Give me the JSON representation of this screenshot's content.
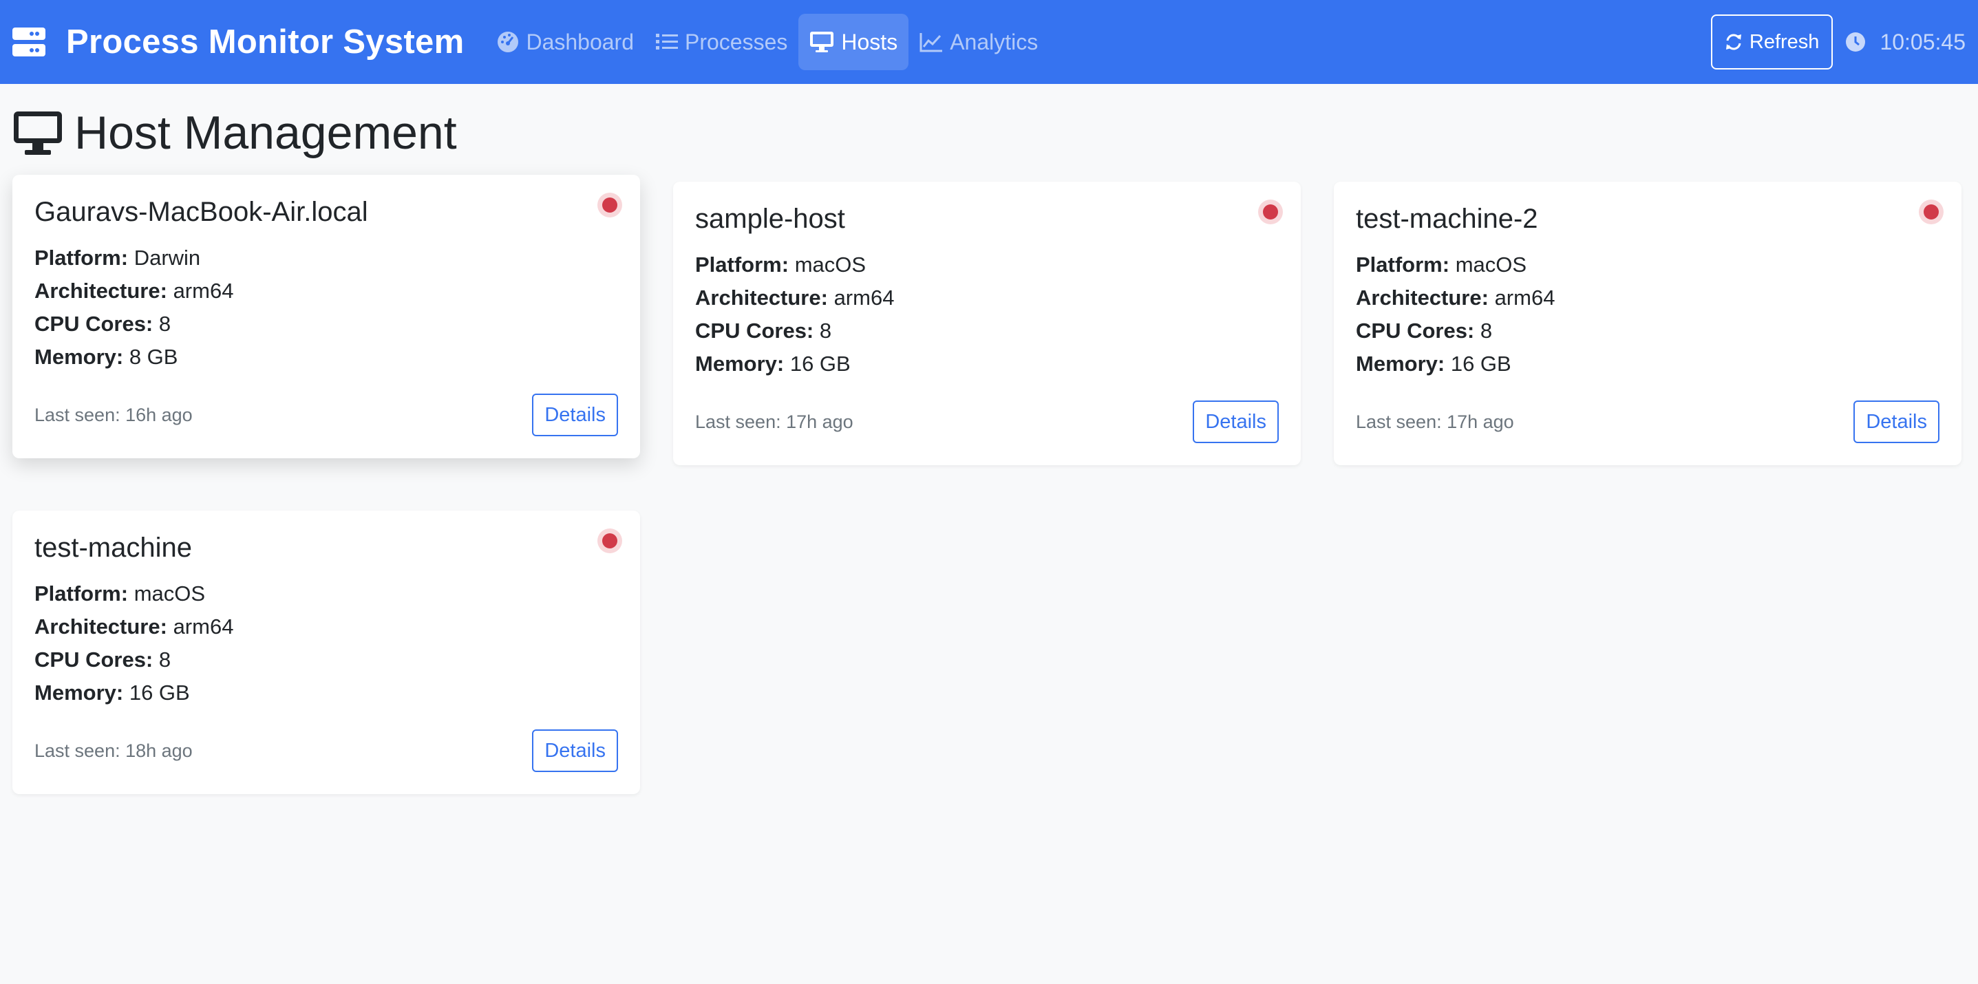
{
  "app": {
    "title": "Process Monitor System",
    "brand_icon": "server-icon",
    "accent_color": "#3673f0"
  },
  "nav": {
    "items": [
      {
        "label": "Dashboard",
        "icon": "gauge-icon",
        "active": false
      },
      {
        "label": "Processes",
        "icon": "list-icon",
        "active": false
      },
      {
        "label": "Hosts",
        "icon": "desktop-icon",
        "active": true
      },
      {
        "label": "Analytics",
        "icon": "chart-line-icon",
        "active": false
      }
    ],
    "refresh_label": "Refresh",
    "time": "10:05:45"
  },
  "page": {
    "title": "Host Management",
    "title_icon": "desktop-icon"
  },
  "labels": {
    "platform": "Platform:",
    "architecture": "Architecture:",
    "cpu_cores": "CPU Cores:",
    "memory": "Memory:",
    "details": "Details"
  },
  "hosts": [
    {
      "name": "Gauravs-MacBook-Air.local",
      "platform": "Darwin",
      "architecture": "arm64",
      "cpu_cores": "8",
      "memory": "8 GB",
      "last_seen": "Last seen: 16h ago",
      "status_color": "#d13a49"
    },
    {
      "name": "sample-host",
      "platform": "macOS",
      "architecture": "arm64",
      "cpu_cores": "8",
      "memory": "16 GB",
      "last_seen": "Last seen: 17h ago",
      "status_color": "#d13a49"
    },
    {
      "name": "test-machine-2",
      "platform": "macOS",
      "architecture": "arm64",
      "cpu_cores": "8",
      "memory": "16 GB",
      "last_seen": "Last seen: 17h ago",
      "status_color": "#d13a49"
    },
    {
      "name": "test-machine",
      "platform": "macOS",
      "architecture": "arm64",
      "cpu_cores": "8",
      "memory": "16 GB",
      "last_seen": "Last seen: 18h ago",
      "status_color": "#d13a49"
    }
  ]
}
